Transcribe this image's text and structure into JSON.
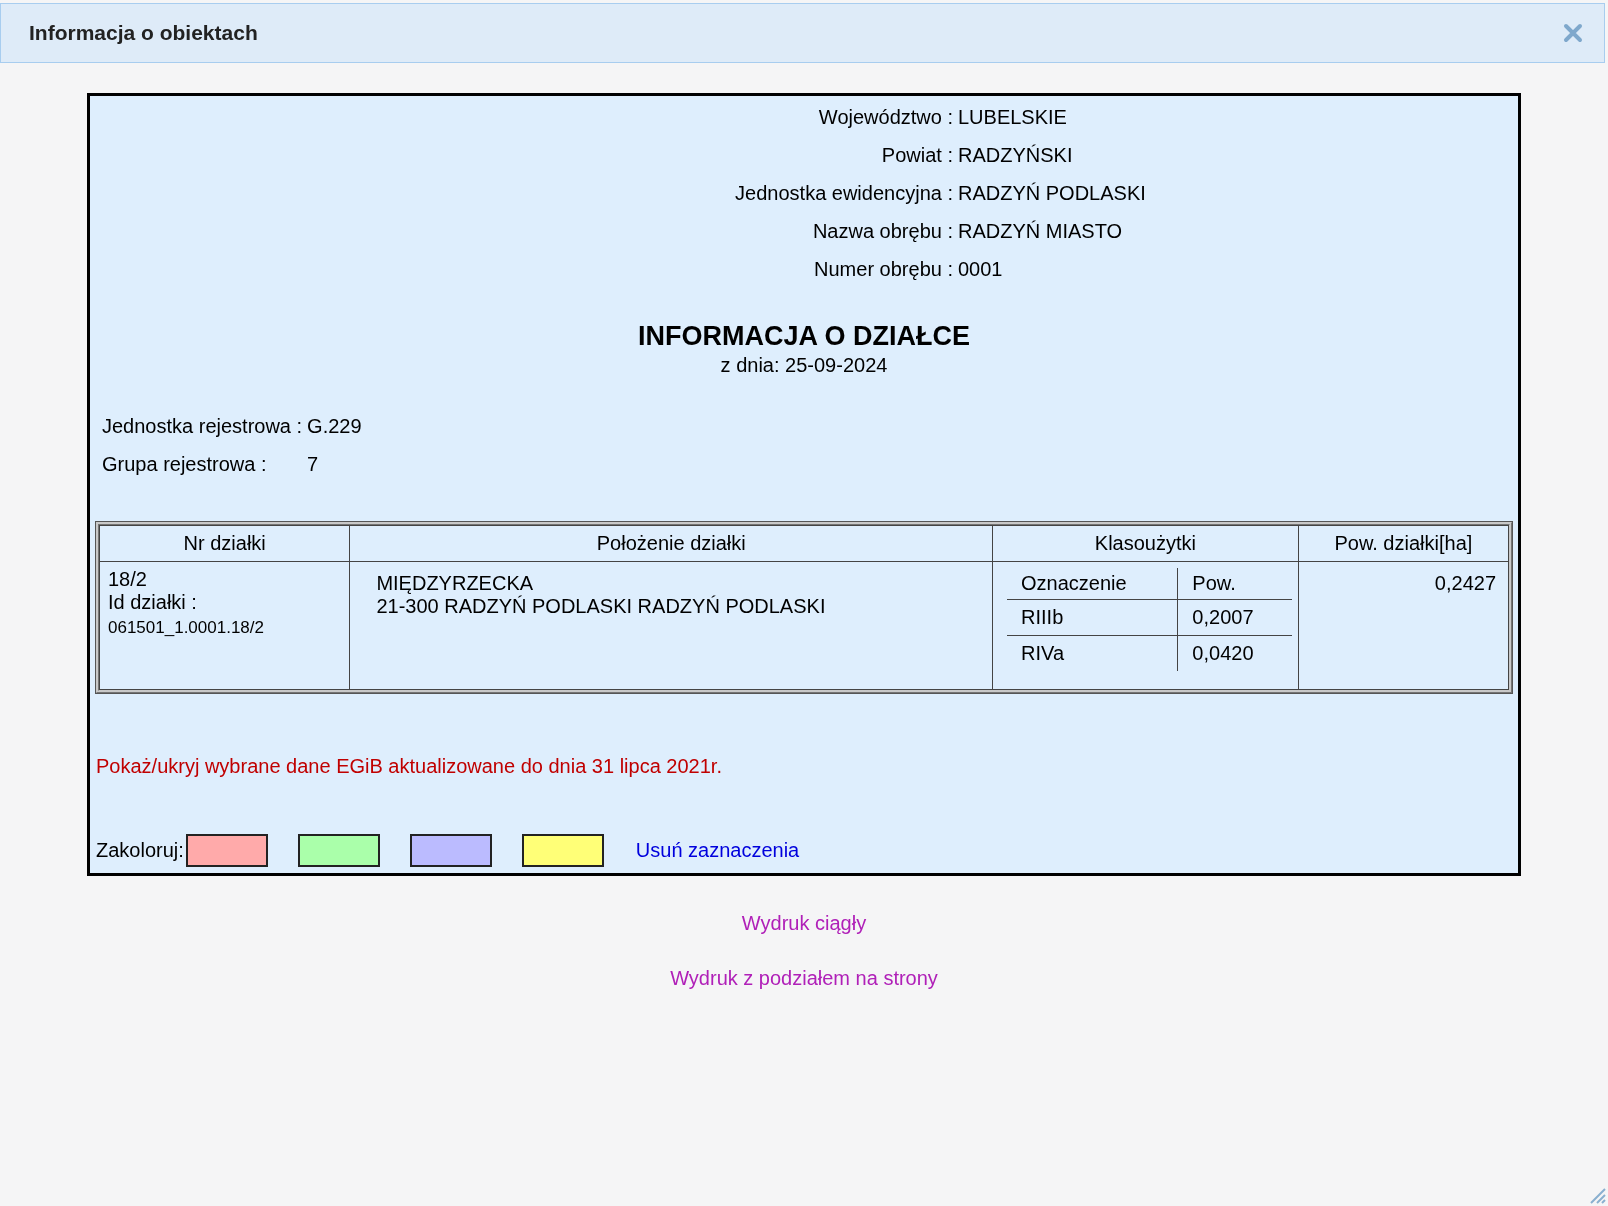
{
  "window": {
    "title": "Informacja o obiektach"
  },
  "location": [
    {
      "label": "Województwo :",
      "value": "LUBELSKIE"
    },
    {
      "label": "Powiat :",
      "value": "RADZYŃSKI"
    },
    {
      "label": "Jednostka ewidencyjna :",
      "value": "RADZYŃ PODLASKI"
    },
    {
      "label": "Nazwa obrębu :",
      "value": "RADZYŃ MIASTO"
    },
    {
      "label": "Numer obrębu :",
      "value": "0001"
    }
  ],
  "heading": "INFORMACJA O DZIAŁCE",
  "date": "z dnia: 25-09-2024",
  "registry": [
    {
      "label": "Jednostka rejestrowa :",
      "value": "G.229"
    },
    {
      "label": "Grupa rejestrowa :",
      "value": "7"
    }
  ],
  "table": {
    "columns": [
      "Nr działki",
      "Położenie działki",
      "Klasoużytki",
      "Pow. działki[ha]"
    ],
    "rows": [
      {
        "number": "18/2",
        "id_label": "Id działki :",
        "id": "061501_1.0001.18/2",
        "location_lines": [
          "MIĘDZYRZECKA",
          "21-300 RADZYŃ PODLASKI RADZYŃ PODLASKI"
        ],
        "land_classes": {
          "columns": [
            "Oznaczenie",
            "Pow."
          ],
          "rows": [
            [
              "RIIIb",
              "0,2007"
            ],
            [
              "RIVa",
              "0,0420"
            ]
          ]
        },
        "area": "0,2427"
      }
    ]
  },
  "toggle_link": "Pokaż/ukryj wybrane dane EGiB aktualizowane do dnia 31 lipca 2021r.",
  "colorize": {
    "label": "Zakoloruj:",
    "swatches": [
      {
        "color": "#ffaaaa"
      },
      {
        "color": "#aaffaa"
      },
      {
        "color": "#bbbbff"
      },
      {
        "color": "#ffff77"
      }
    ],
    "clear_link": "Usuń zaznaczenia"
  },
  "print_links": [
    "Wydruk ciągły",
    "Wydruk z podziałem na strony"
  ]
}
